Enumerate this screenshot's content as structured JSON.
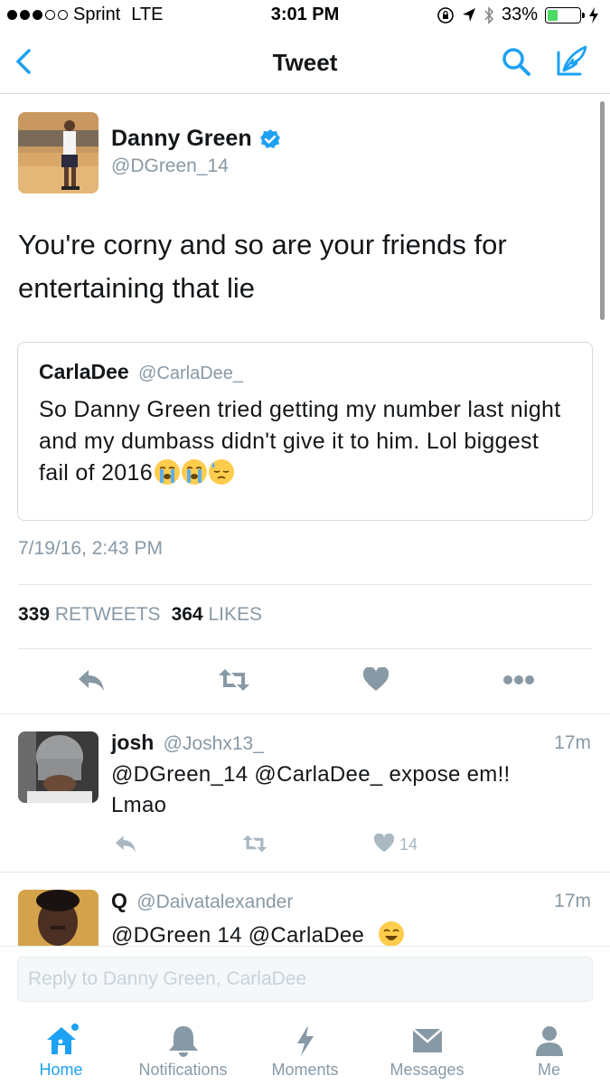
{
  "status_bar": {
    "carrier": "Sprint",
    "network": "LTE",
    "time": "3:01 PM",
    "battery": "33%",
    "battery_level": 0.33
  },
  "nav": {
    "title": "Tweet"
  },
  "tweet": {
    "author_name": "Danny Green",
    "author_handle": "@DGreen_14",
    "text": "You're corny and so are your friends for entertaining that lie",
    "timestamp": "7/19/16, 2:43 PM",
    "retweets_count": "339",
    "retweets_label": "RETWEETS",
    "likes_count": "364",
    "likes_label": "LIKES",
    "quote": {
      "author_name": "CarlaDee",
      "author_handle": "@CarlaDee_",
      "text": "So Danny Green tried getting my number last night and my dumbass didn't give it to him. Lol biggest fail of 2016"
    }
  },
  "replies": [
    {
      "name": "josh",
      "handle": "@Joshx13_",
      "time": "17m",
      "text": "@DGreen_14 @CarlaDee_ expose em!! Lmao",
      "likes": "14"
    },
    {
      "name": "Q",
      "handle": "@Daivatalexander",
      "time": "17m",
      "text": "@DGreen 14 @CarlaDee"
    }
  ],
  "composer": {
    "placeholder": "Reply to Danny Green, CarlaDee"
  },
  "tabs": [
    {
      "label": "Home",
      "icon": "home-icon"
    },
    {
      "label": "Notifications",
      "icon": "bell-icon"
    },
    {
      "label": "Moments",
      "icon": "lightning-icon"
    },
    {
      "label": "Messages",
      "icon": "envelope-icon"
    },
    {
      "label": "Me",
      "icon": "person-icon"
    }
  ],
  "colors": {
    "accent": "#1da1f2",
    "muted": "#8899a6",
    "icon_gray": "#8899a6",
    "verified": "#1da1f2"
  }
}
